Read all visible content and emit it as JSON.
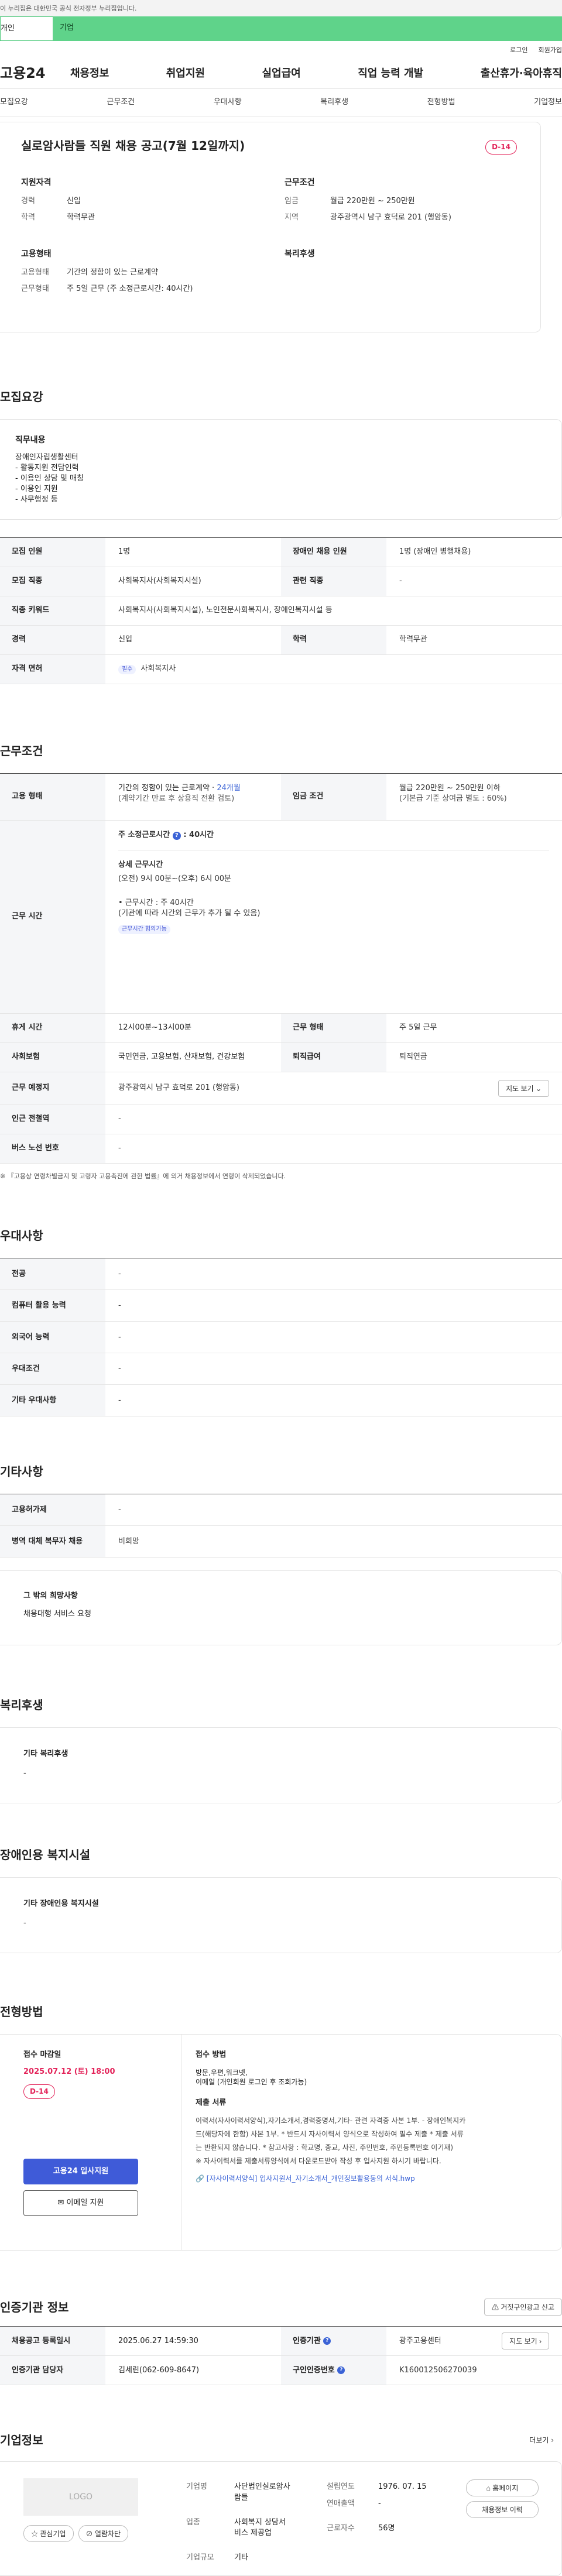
{
  "topbar": {
    "notice": "이 누리집은 대한민국 공식 전자정부 누리집입니다."
  },
  "tabs": {
    "personal": "개인",
    "company": "기업"
  },
  "util": {
    "login": "로그인",
    "join": "회원가입"
  },
  "gnb": {
    "logo": "고용24",
    "menu": [
      "채용정보",
      "취업지원",
      "실업급여",
      "직업 능력 개발",
      "출산휴가·육아휴직"
    ]
  },
  "snb": [
    "모집요강",
    "근무조건",
    "우대사항",
    "복리후생",
    "전형방법",
    "기업정보"
  ],
  "summary": {
    "title": "실로암사람들 직원 채용 공고(7월 12일까지)",
    "dday": "D-14",
    "qual_title": "지원자격",
    "career_k": "경력",
    "career_v": "신입",
    "edu_k": "학력",
    "edu_v": "학력무관",
    "cond_title": "근무조건",
    "wage_k": "임금",
    "wage_v": "월급 220만원 ~ 250만원",
    "loc_k": "지역",
    "loc_v": "광주광역시 남구 효덕로 201 (행암동)",
    "emp_title": "고용형태",
    "type_k": "고용형태",
    "type_v": "기간의 정함이 있는 근로계약",
    "hours_k": "근무형태",
    "hours_v": "주 5일 근무 (주 소정근로시간: 40시간)",
    "welfare_title": "복리후생"
  },
  "recruit": {
    "title": "모집요강",
    "duty_title": "직무내용",
    "duty_lines": [
      "장애인자립생활센터",
      "- 활동지원 전담인력",
      "- 이용인 상담 및 매칭",
      "- 이용인 지원",
      "- 사무행정 등"
    ],
    "rows": [
      {
        "k": "모집 인원",
        "v": "1명",
        "k2": "장애인 채용 인원",
        "v2": "1명 (장애인 병행채용)"
      },
      {
        "k": "모집 직종",
        "v": "사회복지사(사회복지시설)",
        "k2": "관련 직종",
        "v2": "-"
      },
      {
        "k": "직종 키워드",
        "v": "사회복지사(사회복지시설), 노인전문사회복지사, 장애인복지시설 등"
      },
      {
        "k": "경력",
        "v": "신입",
        "k2": "학력",
        "v2": "학력무관"
      },
      {
        "k": "자격 면허",
        "badge": "필수",
        "v": "사회복지사"
      }
    ]
  },
  "work": {
    "title": "근무조건",
    "type_k": "고용 형태",
    "type_v1": "기간의 정함이 있는 근로계약 · ",
    "type_months": "24개월",
    "type_v2": "(계약기간 만료 후 상용직 전환 검토)",
    "wage_k": "임금 조건",
    "wage_v1": "월급 220만원 ~ 250만원 이하",
    "wage_v2": "(기본급 기준 상여금 별도 : 60%)",
    "time_k": "근무 시간",
    "time_head": "주 소정근로시간",
    "time_hours": ": 40시간",
    "time_detail_title": "상세 근무시간",
    "time_detail": "(오전) 9시 00분~(오후) 6시 00분",
    "time_total": "• 근무시간 : 주 40시간",
    "time_note": "(기관에 따라 시간외 근무가 추가 될 수 있음)",
    "time_badge": "근무시간 협의가능",
    "rest_k": "휴게 시간",
    "rest_v": "12시00분~13시00분",
    "form_k": "근무 형태",
    "form_v": "주 5일 근무",
    "ins_k": "사회보험",
    "ins_v": "국민연금, 고용보험, 산재보험, 건강보험",
    "ret_k": "퇴직급여",
    "ret_v": "퇴직연금",
    "place_k": "근무 예정지",
    "place_v": "광주광역시 남구 효덕로 201 (행암동)",
    "map_btn": "지도 보기",
    "subway_k": "인근 전철역",
    "subway_v": "-",
    "bus_k": "버스 노선 번호",
    "bus_v": "-",
    "footnote": "※ 『고용상 연령차별금지 및 고령자 고용촉진에 관한 법률』에 의거 채용정보에서 연령이 삭제되었습니다."
  },
  "pref": {
    "title": "우대사항",
    "rows": [
      {
        "k": "전공",
        "v": "-"
      },
      {
        "k": "컴퓨터 활용 능력",
        "v": "-"
      },
      {
        "k": "외국어 능력",
        "v": "-"
      },
      {
        "k": "우대조건",
        "v": "-"
      },
      {
        "k": "기타 우대사항",
        "v": "-"
      }
    ]
  },
  "etc": {
    "title": "기타사항",
    "rows": [
      {
        "k": "고용허가제",
        "v": "-"
      },
      {
        "k": "병역 대체 복무자 채용",
        "v": "비희망"
      }
    ],
    "box_title": "그 밖의 희망사항",
    "box_v": "채용대행 서비스 요청"
  },
  "welfare": {
    "title": "복리후생",
    "box_title": "기타 복리후생",
    "box_v": "-"
  },
  "disabled": {
    "title": "장애인용 복지시설",
    "box_title": "기타 장애인용 복지시설",
    "box_v": "-"
  },
  "process": {
    "title": "전형방법",
    "deadline_title": "접수 마감일",
    "deadline": "2025.07.12 (토) 18:00",
    "dday": "D-14",
    "apply_btn": "고용24 입사지원",
    "email_btn": "이메일 지원",
    "method_title": "접수 방법",
    "method_v1": "방문,우편,워크넷,",
    "method_v2": "이메일 (개인회원 로그인 후 조회가능)",
    "docs_title": "제출 서류",
    "docs_lines": [
      "이력서(자사이력서양식),자기소개서,경력증명서,기타- 관련 자격증 사본 1부. - 장애인복지카",
      "드(해당자에 한함) 사본 1부. * 반드시 자사이력서 양식으로 작성하여 필수 제출 * 제출 서류",
      "는 반환되지 않습니다. * 참고사항 : 학교명, 종교, 사진, 주민번호, 주민등록번호 이기재)",
      "※ 자사이력서를 제출서류양식에서 다운로드받아 작성 후 입사지원 하시기 바랍니다."
    ],
    "file": "[자사이력서양식] 입사지원서_자기소개서_개인정보활용동의 서식.hwp"
  },
  "agency": {
    "title": "인증기관 정보",
    "report_btn": "거짓구인광고 신고",
    "reg_k": "채용공고 등록일시",
    "reg_v": "2025.06.27 14:59:30",
    "org_k": "인증기관",
    "org_v": "광주고용센터",
    "map_btn": "지도 보기",
    "mgr_k": "인증기관 담당자",
    "mgr_v": "김세린(062-609-8647)",
    "id_k": "구인인증번호",
    "id_v": "K160012506270039"
  },
  "company": {
    "title": "기업정보",
    "more": "더보기",
    "logo": "LOGO",
    "fav_btn": "관심기업",
    "block_btn": "열람차단",
    "name_k": "기업명",
    "name_v1": "사단법인실로암사",
    "name_v2": "람들",
    "found_k": "설립연도",
    "found_v": "1976. 07. 15",
    "sales_k": "연매출액",
    "sales_v": "-",
    "ind_k": "업종",
    "ind_v1": "사회복지 상담서",
    "ind_v2": "비스 제공업",
    "emp_k": "근로자수",
    "emp_v": "56명",
    "size_k": "기업규모",
    "size_v": "기타",
    "home_btn": "홈페이지",
    "job_btn": "채용정보 이력"
  }
}
